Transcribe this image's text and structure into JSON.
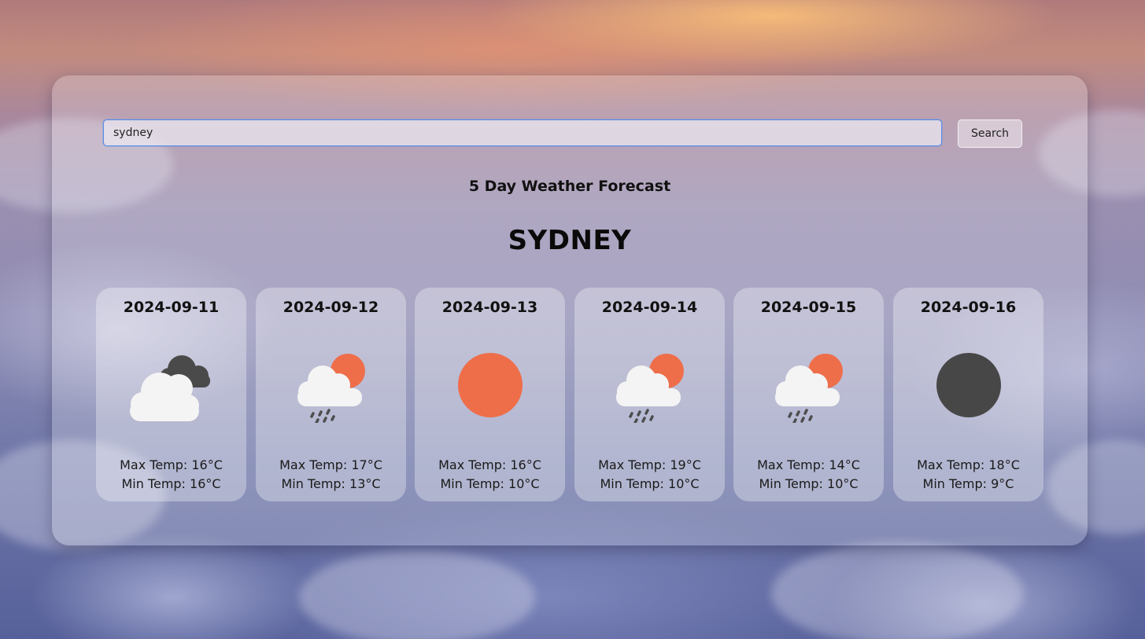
{
  "search": {
    "value": "sydney",
    "button_label": "Search"
  },
  "heading": "5 Day Weather Forecast",
  "city": "SYDNEY",
  "forecast": [
    {
      "date": "2024-09-11",
      "icon": "cloudy-icon",
      "max": "Max Temp: 16°C",
      "min": "Min Temp: 16°C"
    },
    {
      "date": "2024-09-12",
      "icon": "rain-sun-icon",
      "max": "Max Temp: 17°C",
      "min": "Min Temp: 13°C"
    },
    {
      "date": "2024-09-13",
      "icon": "sun-icon",
      "max": "Max Temp: 16°C",
      "min": "Min Temp: 10°C"
    },
    {
      "date": "2024-09-14",
      "icon": "rain-sun-icon",
      "max": "Max Temp: 19°C",
      "min": "Min Temp: 10°C"
    },
    {
      "date": "2024-09-15",
      "icon": "rain-sun-icon",
      "max": "Max Temp: 14°C",
      "min": "Min Temp: 10°C"
    },
    {
      "date": "2024-09-16",
      "icon": "dark-circle-icon",
      "max": "Max Temp: 18°C",
      "min": "Min Temp: 9°C"
    }
  ],
  "colors": {
    "sun": "#ee6e4a",
    "cloud_light": "#f4f4f4",
    "cloud_dark": "#4a4a4a",
    "moon": "#474747",
    "rain": "#4d4d4d",
    "input_border": "#5b8fe6"
  }
}
